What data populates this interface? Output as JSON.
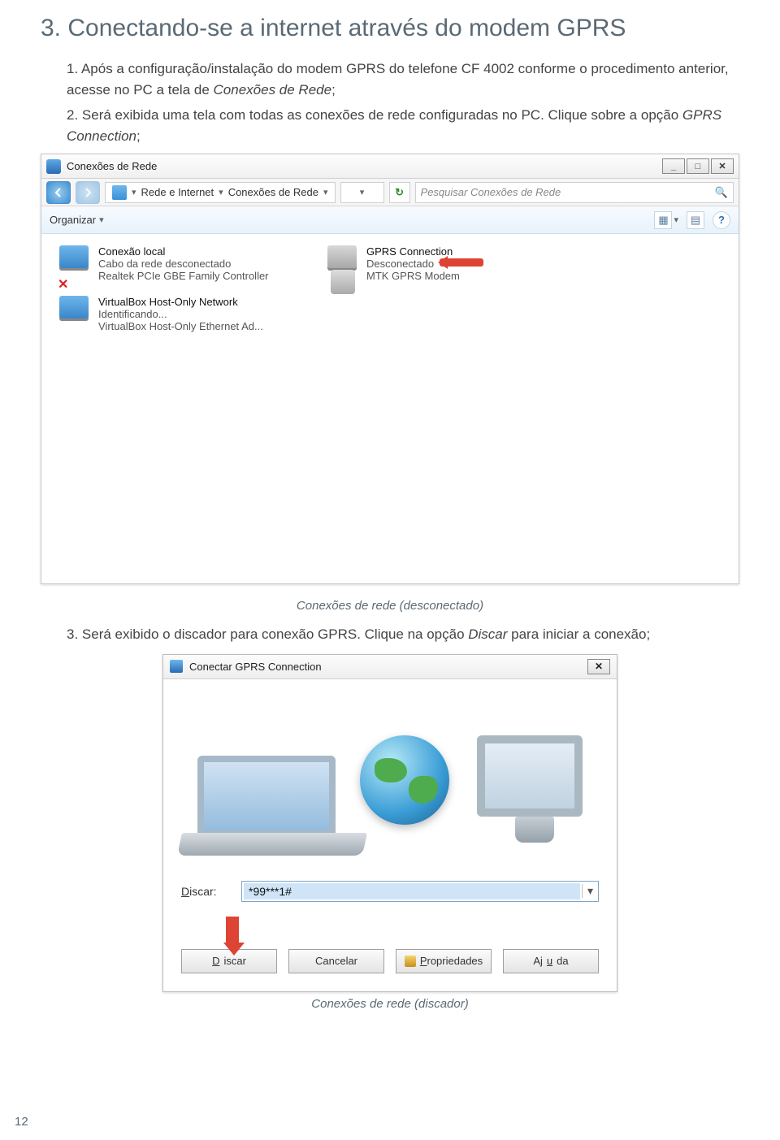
{
  "section_title": "3. Conectando-se a internet através do modem GPRS",
  "steps": {
    "s1_prefix": "1. Após a configuração/instalação do modem GPRS do telefone CF 4002 conforme o procedimento anterior, acesse no PC a tela de ",
    "s1_italic": "Conexões de Rede",
    "s1_suffix": ";",
    "s2_prefix": "2. Será exibida uma tela com todas as conexões de rede configuradas no PC. Clique sobre a opção ",
    "s2_italic": "GPRS Connection",
    "s2_suffix": ";",
    "s3_prefix": "3. Será exibido o discador para conexão GPRS. Clique na opção ",
    "s3_italic": "Discar",
    "s3_suffix": " para iniciar a conexão;"
  },
  "window1": {
    "title": "Conexões de Rede",
    "breadcrumb": {
      "b1": "Rede e Internet",
      "b2": "Conexões de Rede"
    },
    "search_placeholder": "Pesquisar Conexões de Rede",
    "toolbar_organize": "Organizar",
    "items": [
      {
        "name": "Conexão local",
        "line2": "Cabo da rede desconectado",
        "line3": "Realtek PCIe GBE Family Controller"
      },
      {
        "name": "GPRS Connection",
        "line2": "Desconectado",
        "line3": "MTK GPRS Modem"
      },
      {
        "name": "VirtualBox Host-Only Network",
        "line2": "Identificando...",
        "line3": "VirtualBox Host-Only Ethernet Ad..."
      }
    ]
  },
  "caption1": "Conexões de rede (desconectado)",
  "dialer": {
    "title": "Conectar GPRS Connection",
    "dial_label": "Discar:",
    "dial_value": "*99***1#",
    "buttons": {
      "dial": "Discar",
      "cancel": "Cancelar",
      "properties": "Propriedades",
      "help": "Ajuda"
    }
  },
  "caption2": "Conexões de rede (discador)",
  "page_number": "12"
}
